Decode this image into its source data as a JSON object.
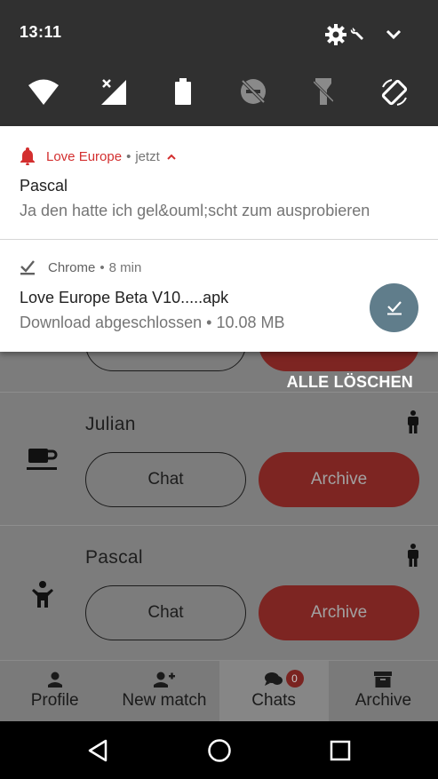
{
  "status_bar": {
    "time": "13:11"
  },
  "notifications": [
    {
      "app": "Love Europe",
      "time": "jetzt",
      "title": "Pascal",
      "text": "Ja den hatte ich gel&ouml;scht zum ausprobieren",
      "accent_color": "#d32f2f"
    },
    {
      "app": "Chrome",
      "time": "8 min",
      "title": "Love Europe Beta V10.....apk",
      "text": "Download abgeschlossen • 10.08 MB",
      "accent_color": "#616161"
    }
  ],
  "clear_all_label": "ALLE LÖSCHEN",
  "matches": [
    {
      "name": "Julian",
      "chat_label": "Chat",
      "archive_label": "Archive",
      "icon": "coffee-cup-icon"
    },
    {
      "name": "Pascal",
      "chat_label": "Chat",
      "archive_label": "Archive",
      "icon": "child-icon"
    }
  ],
  "partial_card": {
    "chat_label": "",
    "archive_label": ""
  },
  "bottom_nav": {
    "items": [
      {
        "label": "Profile",
        "icon": "person-icon"
      },
      {
        "label": "New match",
        "icon": "add-person-icon"
      },
      {
        "label": "Chats",
        "icon": "chat-bubbles-icon",
        "badge": "0"
      },
      {
        "label": "Archive",
        "icon": "archive-box-icon"
      }
    ]
  },
  "colors": {
    "notification_accent": "#d32f2f",
    "download_button": "#607d8b",
    "archive_button": "#7d2522",
    "shade_background": "#303030"
  }
}
